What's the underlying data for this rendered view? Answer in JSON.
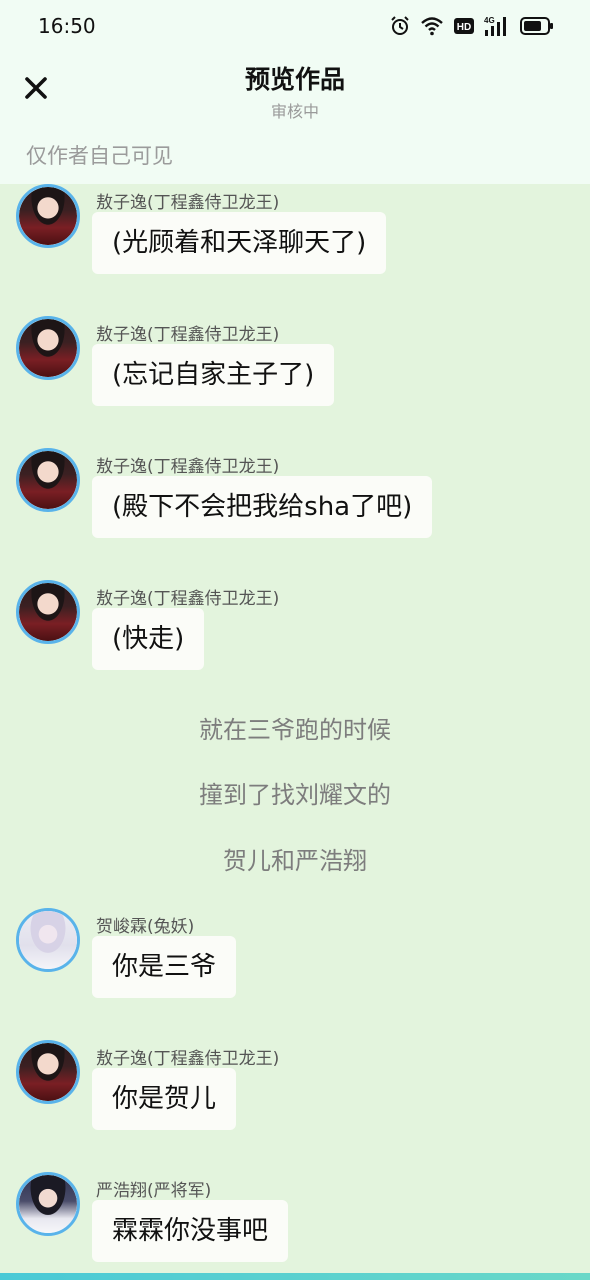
{
  "status_bar": {
    "time": "16:50",
    "icons": [
      "alarm-icon",
      "wifi-icon",
      "hd-icon",
      "signal-4g-icon",
      "battery-icon"
    ],
    "hd_label": "HD",
    "network_label": "4G"
  },
  "nav": {
    "close_icon": "close-icon",
    "title": "预览作品",
    "subtitle": "审核中"
  },
  "visibility_note": "仅作者自己可见",
  "chat": {
    "messages": [
      {
        "speaker": "敖子逸(丁程鑫侍卫龙王)",
        "text": "(光顾着和天泽聊天了)"
      },
      {
        "speaker": "敖子逸(丁程鑫侍卫龙王)",
        "text": "(忘记自家主子了)"
      },
      {
        "speaker": "敖子逸(丁程鑫侍卫龙王)",
        "text": "(殿下不会把我给sha了吧)"
      },
      {
        "speaker": "敖子逸(丁程鑫侍卫龙王)",
        "text": "(快走)"
      },
      {
        "speaker": "贺峻霖(兔妖)",
        "text": "你是三爷"
      },
      {
        "speaker": "敖子逸(丁程鑫侍卫龙王)",
        "text": "你是贺儿"
      },
      {
        "speaker": "严浩翔(严将军)",
        "text": "霖霖你没事吧"
      }
    ],
    "narration": [
      "就在三爷跑的时候",
      "撞到了找刘耀文的",
      "贺儿和严浩翔"
    ]
  },
  "colors": {
    "chat_background": "#e3f4dd",
    "header_background": "#f1fcf4",
    "bubble": "#fbfcf8",
    "avatar_ring": "#59b3ea"
  }
}
